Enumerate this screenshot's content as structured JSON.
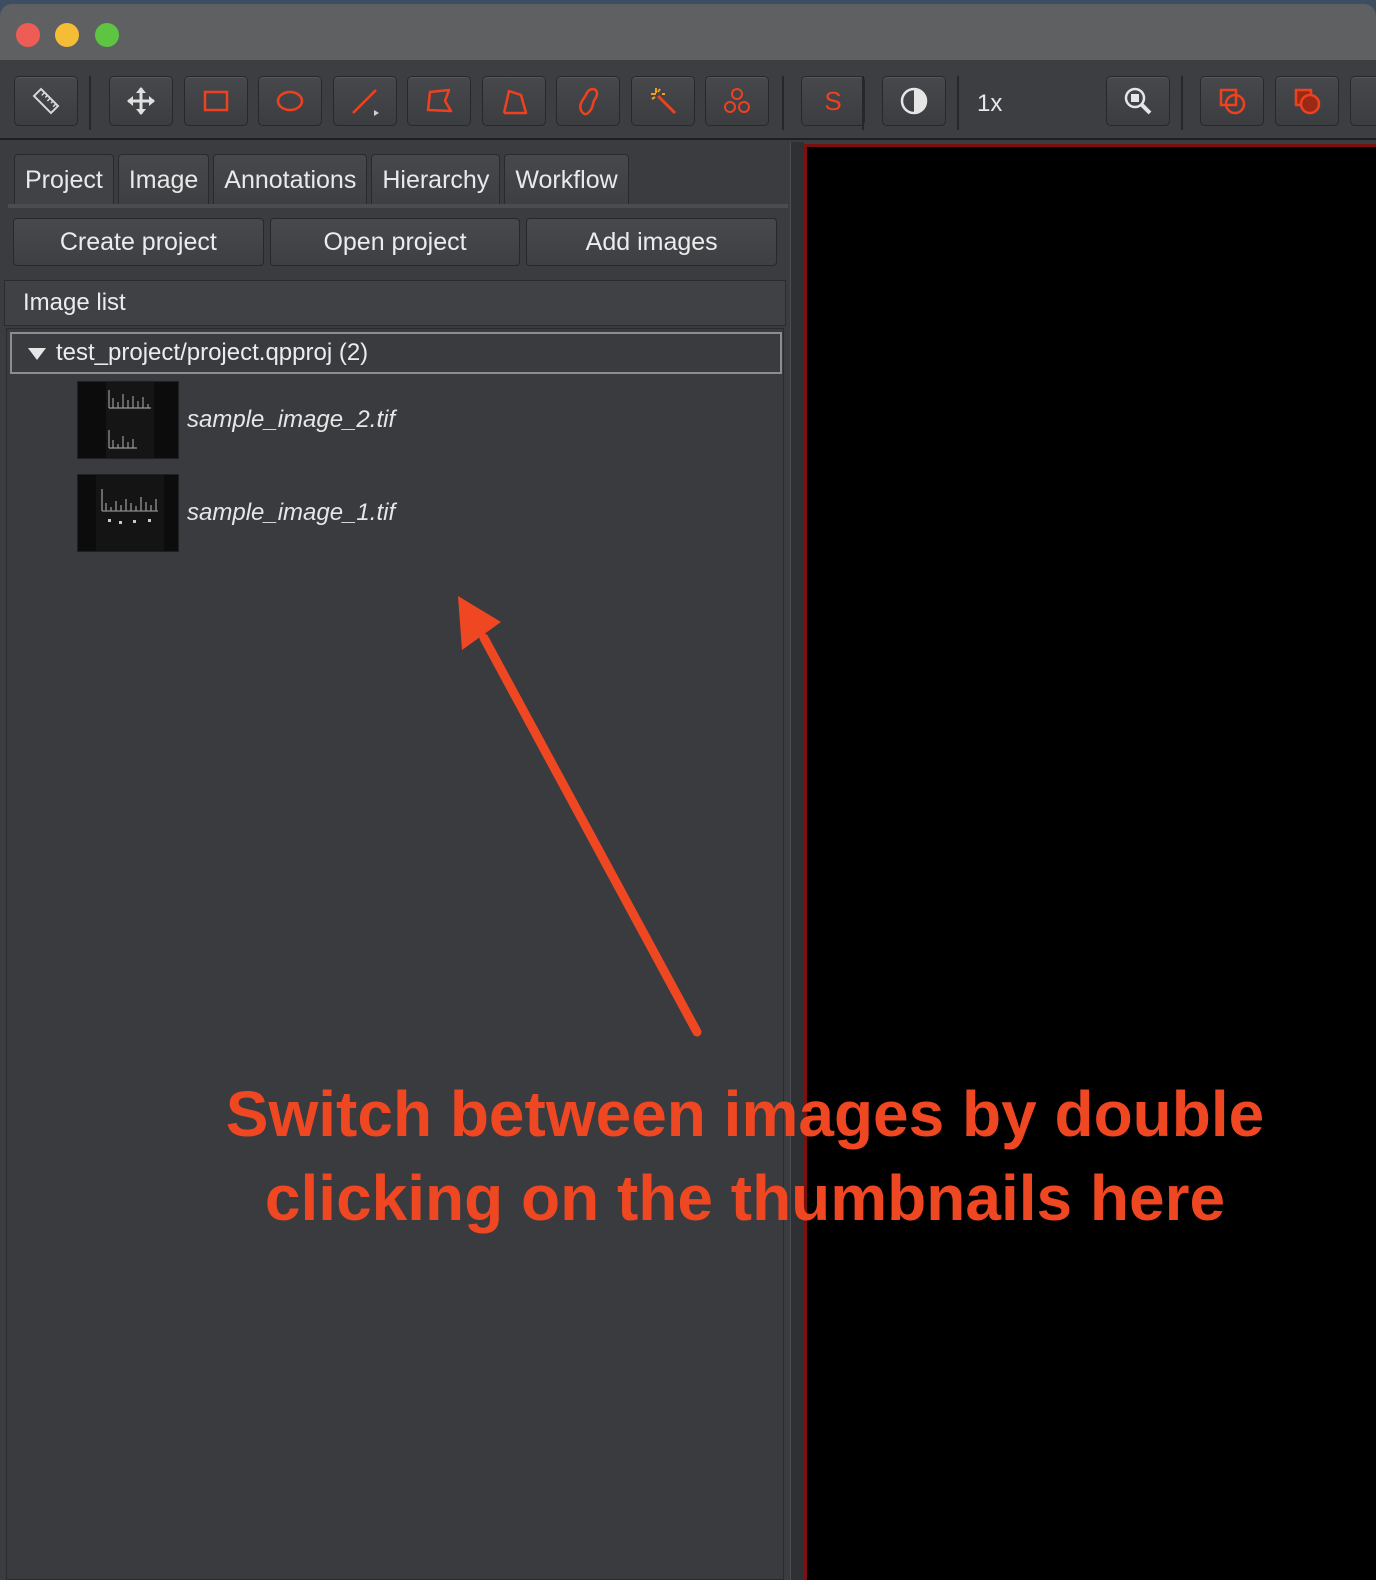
{
  "toolbar": {
    "zoom_label": "1x",
    "icons": [
      "ruler-icon",
      "move-icon",
      "rectangle-icon",
      "ellipse-icon",
      "line-icon",
      "polygon-icon",
      "polyline-icon",
      "brush-icon",
      "wand-icon",
      "points-icon",
      "selection-mode-icon",
      "contrast-icon",
      "zoom-to-fit-icon",
      "show-overlay-icon",
      "fill-overlay-icon"
    ],
    "selection_mode_label": "S",
    "accent_color": "#f0411f"
  },
  "tabs": [
    {
      "label": "Project"
    },
    {
      "label": "Image"
    },
    {
      "label": "Annotations"
    },
    {
      "label": "Hierarchy"
    },
    {
      "label": "Workflow"
    }
  ],
  "actions": {
    "create_project": "Create project",
    "open_project": "Open project",
    "add_images": "Add images"
  },
  "image_list": {
    "header": "Image list",
    "project_label": "test_project/project.qpproj (2)",
    "entries": [
      {
        "name": "sample_image_2.tif"
      },
      {
        "name": "sample_image_1.tif"
      }
    ]
  },
  "annotation": {
    "line1": "Switch between images by double",
    "line2": "clicking on the thumbnails here",
    "color": "#f04723"
  }
}
